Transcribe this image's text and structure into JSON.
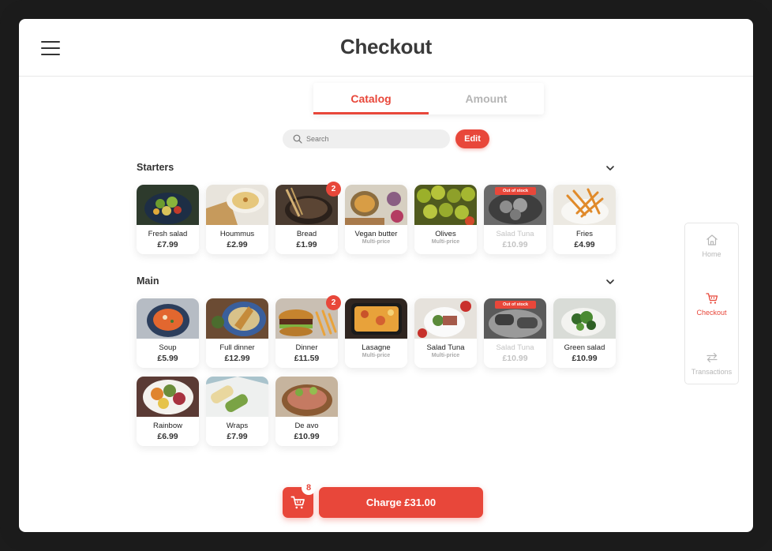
{
  "header": {
    "title": "Checkout",
    "menu_icon": "hamburger-menu-icon"
  },
  "tabs": [
    {
      "label": "Catalog",
      "active": true
    },
    {
      "label": "Amount",
      "active": false
    }
  ],
  "search": {
    "placeholder": "Search",
    "value": ""
  },
  "edit_label": "Edit",
  "sections": [
    {
      "title": "Starters",
      "items": [
        {
          "name": "Fresh salad",
          "price": "£7.99",
          "subtitle": "",
          "count": "",
          "out_of_stock": false,
          "image": "salad"
        },
        {
          "name": "Hoummus",
          "price": "£2.99",
          "subtitle": "",
          "count": "",
          "out_of_stock": false,
          "image": "hummus"
        },
        {
          "name": "Bread",
          "price": "£1.99",
          "subtitle": "",
          "count": "2",
          "out_of_stock": false,
          "image": "bread"
        },
        {
          "name": "Vegan butter",
          "price": "",
          "subtitle": "Multi-price",
          "count": "",
          "out_of_stock": false,
          "image": "butter"
        },
        {
          "name": "Olives",
          "price": "",
          "subtitle": "Multi-price",
          "count": "",
          "out_of_stock": false,
          "image": "olives"
        },
        {
          "name": "Salad Tuna",
          "price": "£10.99",
          "subtitle": "",
          "count": "",
          "out_of_stock": true,
          "image": "tuna"
        },
        {
          "name": "Fries",
          "price": "£4.99",
          "subtitle": "",
          "count": "",
          "out_of_stock": false,
          "image": "fries"
        }
      ]
    },
    {
      "title": "Main",
      "items": [
        {
          "name": "Soup",
          "price": "£5.99",
          "subtitle": "",
          "count": "",
          "out_of_stock": false,
          "image": "soup"
        },
        {
          "name": "Full dinner",
          "price": "£12.99",
          "subtitle": "",
          "count": "",
          "out_of_stock": false,
          "image": "fullDinner"
        },
        {
          "name": "Dinner",
          "price": "£11.59",
          "subtitle": "",
          "count": "2",
          "out_of_stock": false,
          "image": "burger"
        },
        {
          "name": "Lasagne",
          "price": "",
          "subtitle": "Multi-price",
          "count": "",
          "out_of_stock": false,
          "image": "lasagne"
        },
        {
          "name": "Salad Tuna",
          "price": "",
          "subtitle": "Multi-price",
          "count": "",
          "out_of_stock": false,
          "image": "saladTuna"
        },
        {
          "name": "Salad Tuna",
          "price": "£10.99",
          "subtitle": "",
          "count": "",
          "out_of_stock": true,
          "image": "grill"
        },
        {
          "name": "Green salad",
          "price": "£10.99",
          "subtitle": "",
          "count": "",
          "out_of_stock": false,
          "image": "greens"
        },
        {
          "name": "Rainbow",
          "price": "£6.99",
          "subtitle": "",
          "count": "",
          "out_of_stock": false,
          "image": "rainbow"
        },
        {
          "name": "Wraps",
          "price": "£7.99",
          "subtitle": "",
          "count": "",
          "out_of_stock": false,
          "image": "wraps"
        },
        {
          "name": "De avo",
          "price": "£10.99",
          "subtitle": "",
          "count": "",
          "out_of_stock": false,
          "image": "avo"
        }
      ]
    }
  ],
  "out_of_stock_label": "Out of stock",
  "side_nav": [
    {
      "label": "Home",
      "icon": "home-icon",
      "active": false
    },
    {
      "label": "Checkout",
      "icon": "cart-icon",
      "active": true
    },
    {
      "label": "Transactions",
      "icon": "swap-arrows-icon",
      "active": false
    }
  ],
  "cart": {
    "count": "8",
    "icon": "cart-icon"
  },
  "charge_label": "Charge £31.00",
  "colors": {
    "accent": "#e8473a",
    "text": "#333333",
    "muted": "#b5b5b5"
  }
}
